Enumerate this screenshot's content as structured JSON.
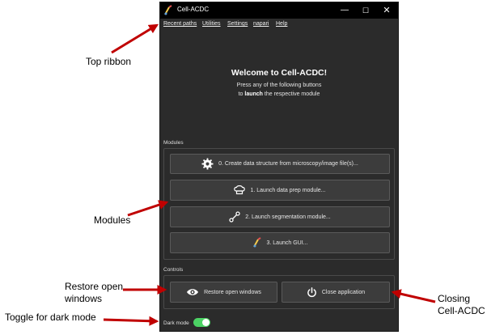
{
  "window": {
    "title": "Cell-ACDC"
  },
  "menu": {
    "items": [
      "Recent paths",
      "Utilities",
      "Settings",
      "napari",
      "Help"
    ]
  },
  "welcome": {
    "title": "Welcome to Cell-ACDC!",
    "line1": "Press any of the following buttons",
    "line2_prefix": "to ",
    "line2_bold": "launch",
    "line2_suffix": " the respective module"
  },
  "modules": {
    "label": "Modules",
    "buttons": [
      {
        "label": "0. Create data structure from microscopy/image file(s)...",
        "icon": "gear-icon"
      },
      {
        "label": "1. Launch data prep module...",
        "icon": "chef-hat-icon"
      },
      {
        "label": "2. Launch segmentation module...",
        "icon": "segmentation-icon"
      },
      {
        "label": "3. Launch GUI...",
        "icon": "app-logo-icon"
      }
    ]
  },
  "controls": {
    "label": "Controls",
    "restore_label": "Restore open windows",
    "close_label": "Close application"
  },
  "dark_mode": {
    "label": "Dark mode",
    "enabled": true
  },
  "annotations": {
    "top_ribbon": "Top ribbon",
    "modules": "Modules",
    "restore_line1": "Restore open",
    "restore_line2": "windows",
    "toggle": "Toggle for dark mode",
    "closing_line1": "Closing",
    "closing_line2": "Cell-ACDC"
  },
  "colors": {
    "window_bg": "#2b2b2b",
    "titlebar_bg": "#000000",
    "button_bg": "#3c3c3c",
    "toggle_on": "#4cd264",
    "annotation_arrow": "#c00000"
  }
}
